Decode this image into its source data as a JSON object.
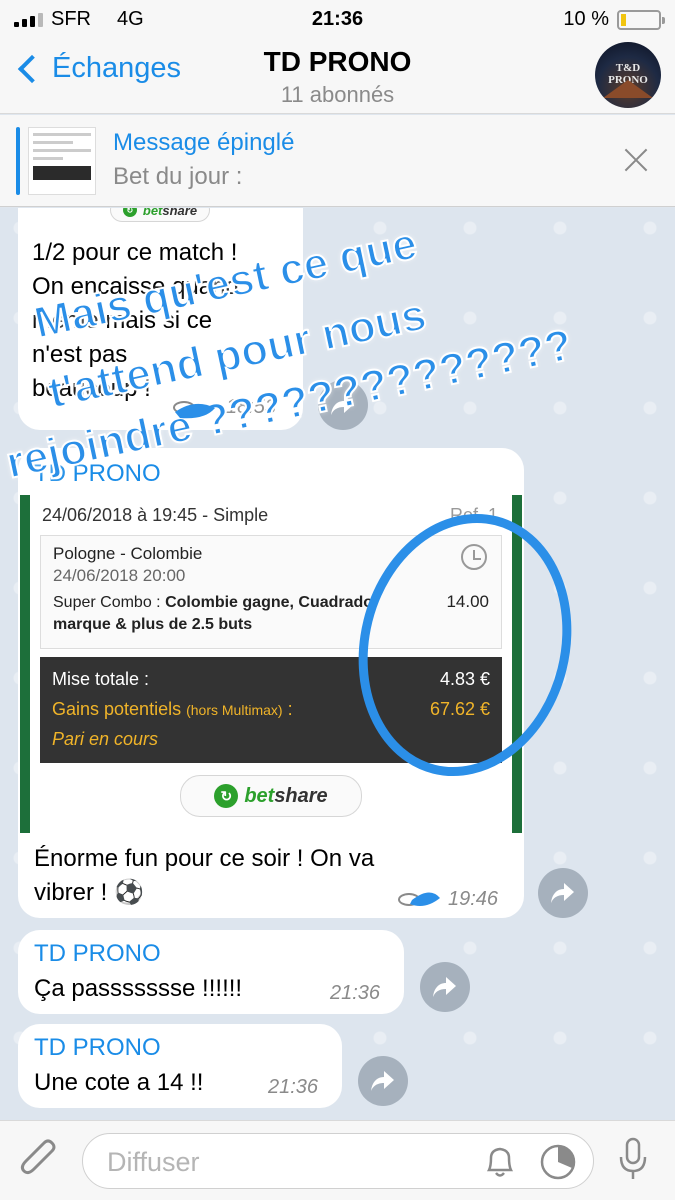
{
  "status_bar": {
    "carrier": "SFR",
    "network": "4G",
    "time": "21:36",
    "battery": "10 %"
  },
  "header": {
    "back_label": "Échanges",
    "title": "TD PRONO",
    "subtitle": "11 abonnés",
    "avatar_text": "T&D PRONO"
  },
  "pinned": {
    "title": "Message épinglé",
    "text": "Bet du jour :"
  },
  "messages": [
    {
      "logo": {
        "b": "bet",
        "s": "share"
      },
      "lines": [
        "1/2 pour ce match !",
        "On encaisse quand",
        "même mais si ce",
        "n'est pas",
        "beaucoup !"
      ],
      "time": "18:53"
    },
    {
      "sender": "TD PRONO",
      "bet": {
        "date": "24/06/2018 à 19:45 - Simple",
        "ref": "Ref. 1",
        "match": "Pologne - Colombie",
        "match_date": "24/06/2018 20:00",
        "combo_prefix": "Super Combo : ",
        "combo": "Colombie gagne, Cuadrado marque & plus de 2.5 buts",
        "odds": "14.00",
        "mise_label": "Mise totale :",
        "mise_value": "4.83 €",
        "gains_label": "Gains potentiels",
        "gains_small": "(hors Multimax)",
        "gains_colon": " :",
        "gains_value": "67.62 €",
        "status": "Pari en cours"
      },
      "logo": {
        "b": "bet",
        "s": "share"
      },
      "lines": [
        "Énorme fun pour ce soir ! On va",
        "vibrer ! ⚽"
      ],
      "time": "19:46"
    },
    {
      "sender": "TD PRONO",
      "text": "Ça passssssse !!!!!!",
      "time": "21:36"
    },
    {
      "sender": "TD PRONO",
      "text": "Une cote a 14 !!",
      "time": "21:36"
    }
  ],
  "overlay": {
    "line1": "Mais qu'est ce que",
    "line2": "t'attend pour nous",
    "line3": "rejoindre ??????????????"
  },
  "input": {
    "placeholder": "Diffuser"
  },
  "colors": {
    "accent": "#1a8ce7",
    "betshare_green": "#2ca02c",
    "card_border": "#1d6f3a",
    "gold": "#f0b429",
    "overlay_blue": "#2b8fe8"
  }
}
